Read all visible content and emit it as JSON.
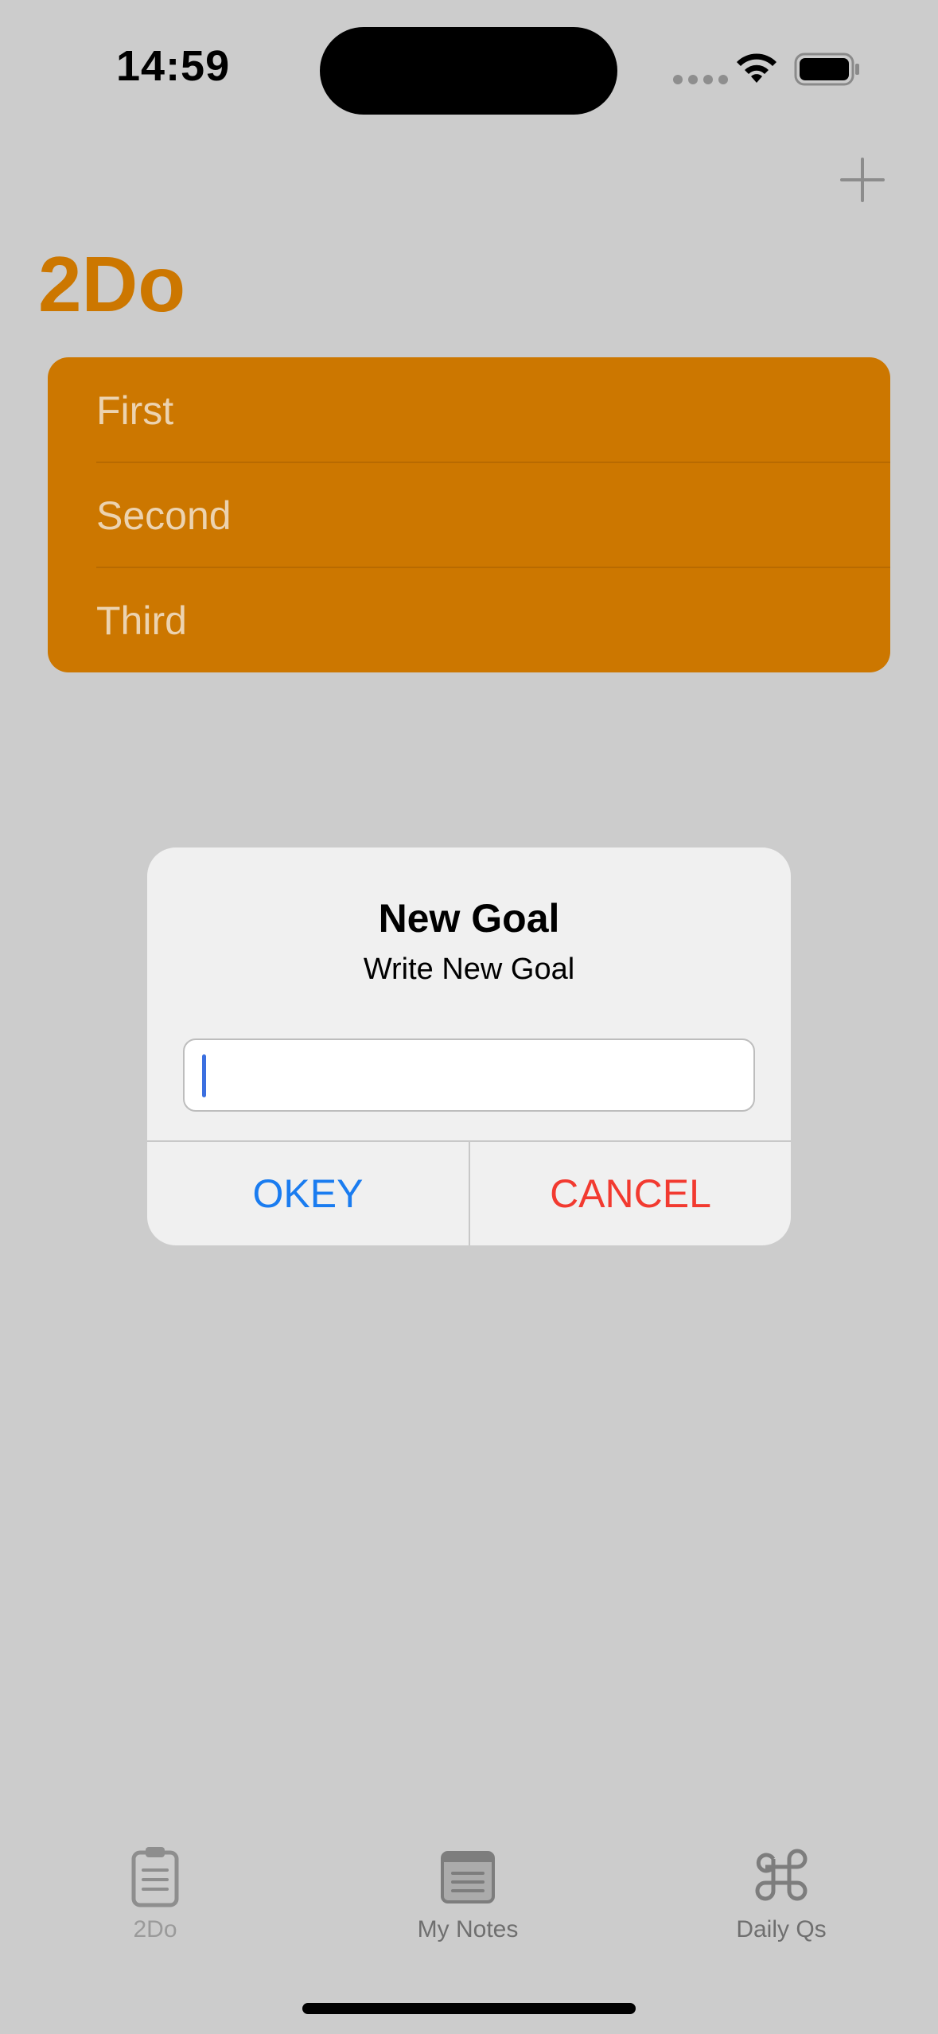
{
  "status_bar": {
    "time": "14:59"
  },
  "nav": {
    "add_icon": "plus-icon",
    "title": "2Do"
  },
  "list": {
    "items": [
      {
        "label": "First"
      },
      {
        "label": "Second"
      },
      {
        "label": "Third"
      }
    ]
  },
  "alert": {
    "title": "New Goal",
    "message": "Write New Goal",
    "input_value": "",
    "okey_label": "OKEY",
    "cancel_label": "CANCEL"
  },
  "tab_bar": {
    "tabs": [
      {
        "label": "2Do",
        "icon": "clipboard-icon",
        "active": true
      },
      {
        "label": "My Notes",
        "icon": "notes-icon",
        "active": false
      },
      {
        "label": "Daily Qs",
        "icon": "command-icon",
        "active": false
      }
    ]
  },
  "colors": {
    "accent": "#cc7700",
    "background": "#cccccc",
    "okey": "#1a7cf0",
    "cancel": "#f23a30"
  }
}
